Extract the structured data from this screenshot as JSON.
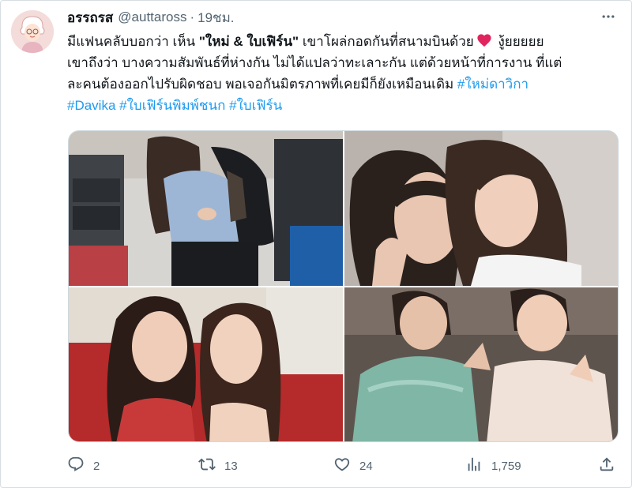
{
  "author": {
    "display_name": "อรรถรส",
    "handle": "@auttaross",
    "separator": "·",
    "time": "19ชม."
  },
  "tweet": {
    "line1": {
      "pre": "มีแฟนคลับบอกว่า  เห็น ",
      "quote": "\"ใหม่ & ใบเฟิร์น\"",
      "post": " เขาโผล่กอดกันที่สนามบินด้วย",
      "after_heart": " งู้ยยยยย"
    },
    "line2": "เขาถึงว่า บางความสัมพันธ์ที่ห่างกัน ไม่ได้แปลว่าทะเลาะกัน แต่ด้วยหน้าที่การงาน ที่แต่",
    "line3": {
      "text": "ละคนต้องออกไปรับผิดชอบ  พอเจอกันมิตรภาพที่เคยมีก็ยังเหมือนเดิม ",
      "hashtag": "#ใหม่ดาวิกา"
    },
    "hashtags": [
      "#Davika",
      "#ใบเฟิร์นพิมพ์ชนก",
      "#ใบเฟิร์น"
    ]
  },
  "actions": {
    "replies": "2",
    "retweets": "13",
    "likes": "24",
    "views": "1,759"
  },
  "icons": {
    "more": "more-dots-icon",
    "reply": "reply-icon",
    "retweet": "retweet-icon",
    "like": "heart-icon",
    "views": "analytics-icon",
    "share": "share-icon",
    "emoji": "red-heart-emoji"
  },
  "colors": {
    "link": "#1d9bf0",
    "secondary_text": "#536471",
    "primary_text": "#0f1419",
    "emoji_heart": "#e0245e"
  }
}
